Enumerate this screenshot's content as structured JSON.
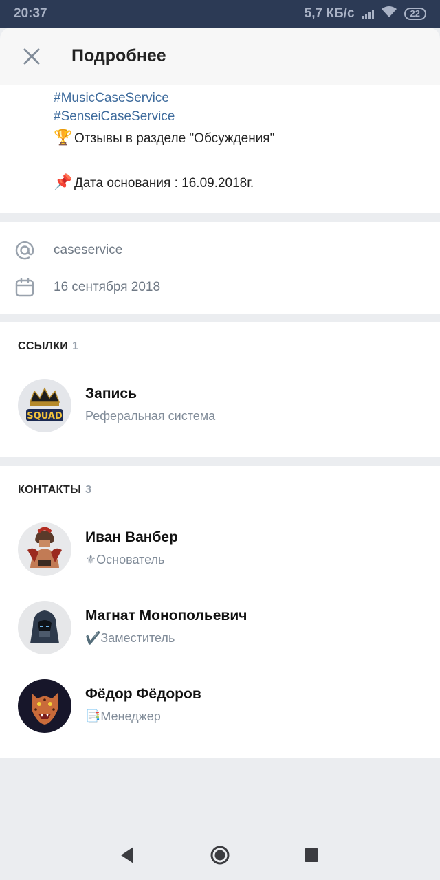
{
  "status_bar": {
    "time": "20:37",
    "network_speed": "5,7 КБ/с",
    "battery": "22"
  },
  "header": {
    "title": "Подробнее",
    "close_icon": "close-icon"
  },
  "description": {
    "tag1": "#MusicCaseService",
    "tag2": "#SenseiCaseService",
    "reviews_emoji": "🏆",
    "reviews_text": "Отзывы в разделе \"Обсуждения\"",
    "founded_emoji": "📌",
    "founded_text": "Дата основания : 16.09.2018г."
  },
  "info": {
    "handle_icon": "at-icon",
    "handle": "caseservice",
    "date_icon": "calendar-icon",
    "date": "16 сентября 2018"
  },
  "links": {
    "title": "ССЫЛКИ",
    "count": "1",
    "items": [
      {
        "name": "Запись",
        "subtitle": "Реферальная система"
      }
    ]
  },
  "contacts": {
    "title": "КОНТАКТЫ",
    "count": "3",
    "items": [
      {
        "name": "Иван Ванбер",
        "subtitle": "⚜Основатель"
      },
      {
        "name": "Магнат Монопольевич",
        "subtitle": "✔️Заместитель"
      },
      {
        "name": "Фёдор Фёдоров",
        "subtitle": "📑Менеджер"
      }
    ]
  },
  "colors": {
    "accent_link": "#3e6b9c",
    "status_bar": "#2c3a55",
    "background": "#ebedf0"
  }
}
